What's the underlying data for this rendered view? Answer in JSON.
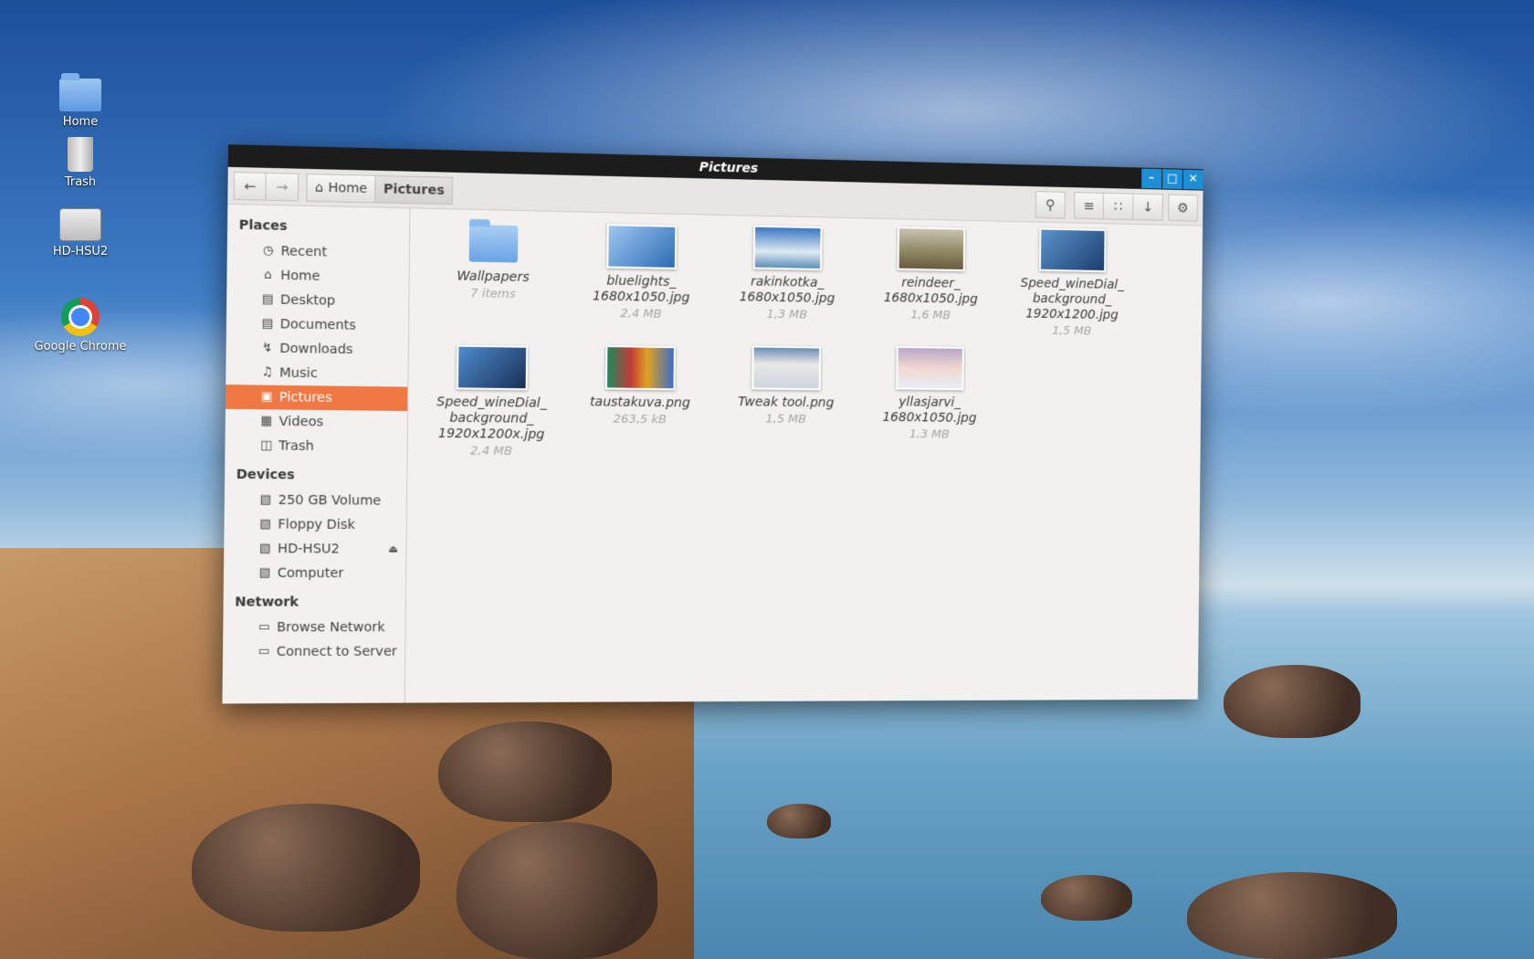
{
  "desktop": {
    "icons": [
      {
        "label": "Home"
      },
      {
        "label": "Trash"
      },
      {
        "label": "HD-HSU2"
      },
      {
        "label": "Google Chrome"
      }
    ]
  },
  "window": {
    "title": "Pictures",
    "buttons": {
      "minimize": "–",
      "maximize": "□",
      "close": "✕"
    }
  },
  "toolbar": {
    "back_icon": "arrow-left-icon",
    "forward_icon": "arrow-right-icon",
    "breadcrumbs": [
      "Home",
      "Pictures"
    ],
    "icons": [
      "search-icon",
      "list-view-icon",
      "grid-view-icon",
      "sort-down-icon",
      "gear-icon"
    ]
  },
  "sidebar": {
    "sections": [
      {
        "title": "Places",
        "items": [
          "Recent",
          "Home",
          "Desktop",
          "Documents",
          "Downloads",
          "Music",
          "Pictures",
          "Videos",
          "Trash"
        ]
      },
      {
        "title": "Devices",
        "items": [
          "250 GB Volume",
          "Floppy Disk",
          "HD-HSU2",
          "Computer"
        ]
      },
      {
        "title": "Network",
        "items": [
          "Browse Network",
          "Connect to Server"
        ]
      }
    ],
    "active_item": "Pictures"
  },
  "files": [
    {
      "name": "Wallpapers",
      "meta": "7 items",
      "color": "#6aa3e6"
    },
    {
      "name": "bluelights_\n1680x1050.jpg",
      "meta": "2,4 MB",
      "color": "#3f7fc8"
    },
    {
      "name": "rakinkotka_\n1680x1050.jpg",
      "meta": "1,3 MB",
      "color": "#2f6fb8"
    },
    {
      "name": "reindeer_\n1680x1050.jpg",
      "meta": "1,6 MB",
      "color": "#7d8a5f"
    },
    {
      "name": "Speed_wineDial_\nbackground_\n1920x1200.jpg",
      "meta": "1,5 MB",
      "color": "#3a6da8"
    },
    {
      "name": "Speed_wineDial_\nbackground_\n1920x1200x.jpg",
      "meta": "2,4 MB",
      "color": "#2a5d98"
    },
    {
      "name": "taustakuva.png",
      "meta": "263,5 kB",
      "color": "#1e8a5a"
    },
    {
      "name": "Tweak tool.png",
      "meta": "1,5 MB",
      "color": "#6b8db8"
    },
    {
      "name": "yllasjarvi_\n1680x1050.jpg",
      "meta": "1,3 MB",
      "color": "#b9a7c9"
    }
  ]
}
